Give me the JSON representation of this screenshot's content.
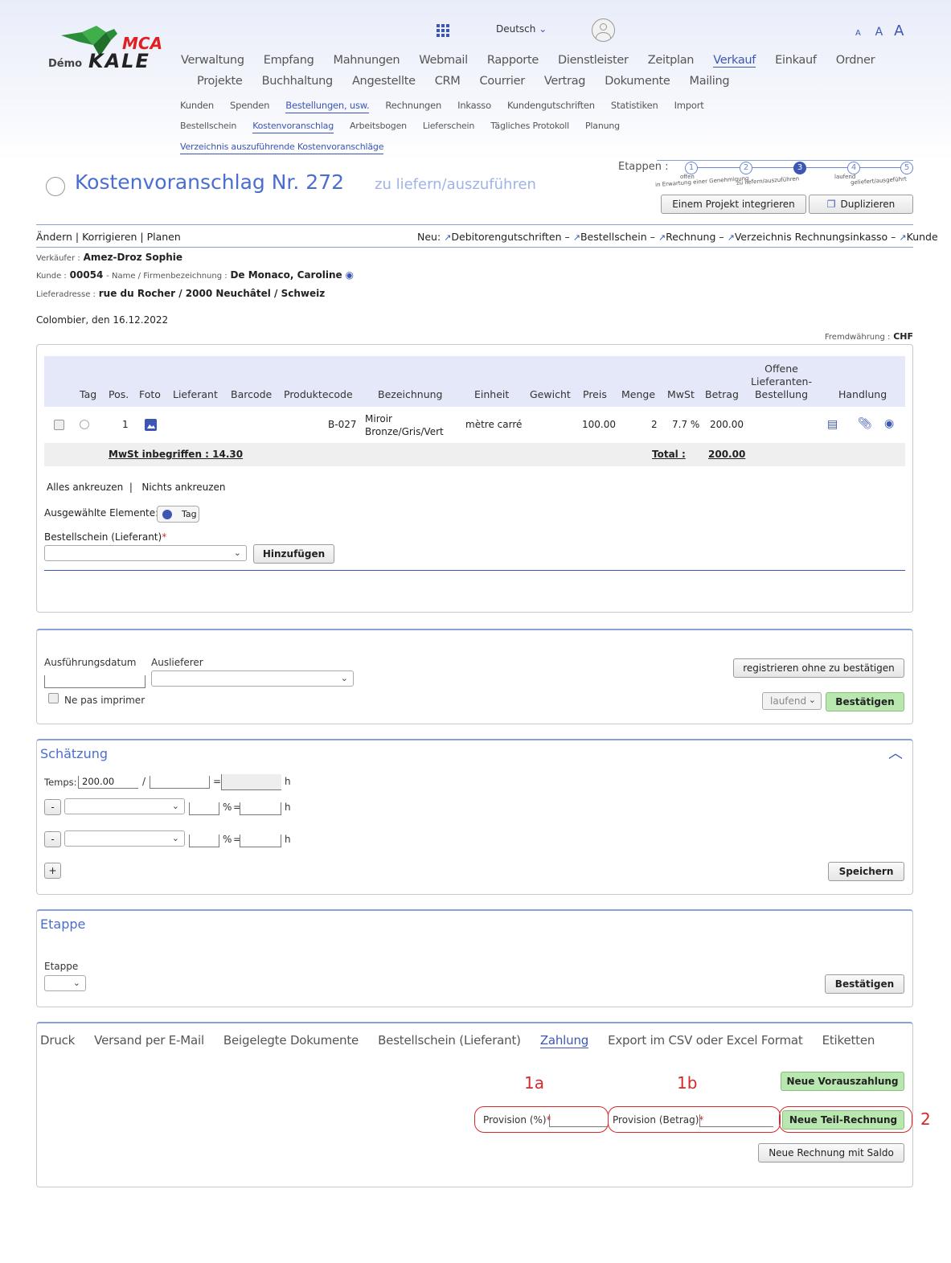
{
  "header": {
    "logo_mca": "MCA",
    "logo_demo": "Démo",
    "logo_kale": "KALE",
    "language": "Deutsch",
    "font_sizes": [
      "A",
      "A",
      "A"
    ],
    "nav_main_row1": [
      "Verwaltung",
      "Empfang",
      "Mahnungen",
      "Webmail",
      "Rapporte",
      "Dienstleister",
      "Zeitplan",
      "Verkauf",
      "Einkauf",
      "Ordner"
    ],
    "nav_main_row2": [
      "Projekte",
      "Buchhaltung",
      "Angestellte",
      "CRM",
      "Courrier",
      "Vertrag",
      "Dokumente",
      "Mailing"
    ],
    "nav_sub_row1": [
      "Kunden",
      "Spenden",
      "Bestellungen, usw.",
      "Rechnungen",
      "Inkasso",
      "Kundengutschriften",
      "Statistiken",
      "Import"
    ],
    "nav_sub_row2": [
      "Bestellschein",
      "Kostenvoranschlag",
      "Arbeitsbogen",
      "Lieferschein",
      "Tägliches Protokoll",
      "Planung"
    ],
    "nav_sub_row3": [
      "Verzeichnis auszuführende Kostenvoranschläge"
    ]
  },
  "title": {
    "main": "Kostenvoranschlag Nr. 272",
    "status": "zu liefern/auszuführen",
    "stages_label": "Etappen :",
    "stages": [
      {
        "num": "1",
        "label": "offen",
        "sub": ""
      },
      {
        "num": "2",
        "label": "in Erwartung einer Genehmigung",
        "sub": ""
      },
      {
        "num": "3",
        "label": "zu liefern/auszuführen",
        "sub": ""
      },
      {
        "num": "4",
        "label": "laufend",
        "sub": ""
      },
      {
        "num": "5",
        "label": "geliefert/ausgeführt",
        "sub": ""
      }
    ],
    "btn_project": "Einem Projekt integrieren",
    "btn_duplicate": "Duplizieren"
  },
  "actions": {
    "left": "Ändern | Korrigieren | Planen",
    "new_label": "Neu:",
    "new_items": [
      "Debitorengutschriften",
      "Bestellschein",
      "Rechnung",
      "Verzeichnis Rechnungsinkasso",
      "Kunde"
    ]
  },
  "info": {
    "seller_label": "Verkäufer :",
    "seller": "Amez-Droz Sophie",
    "client_label": "Kunde :",
    "client_no": "00054",
    "name_label": "- Name / Firmenbezeichnung :",
    "client_name": "De Monaco, Caroline",
    "address_label": "Lieferadresse :",
    "address": "rue du Rocher / 2000 Neuchâtel / Schweiz",
    "place_date": "Colombier, den 16.12.2022",
    "currency_label": "Fremdwährung :",
    "currency": "CHF"
  },
  "table": {
    "headers": [
      "Tag",
      "Pos.",
      "Foto",
      "Lieferant",
      "Barcode",
      "Produktecode",
      "Bezeichnung",
      "Einheit",
      "Gewicht",
      "Preis",
      "Menge",
      "MwSt",
      "Betrag",
      "Offene Lieferanten-Bestellung",
      "Handlung"
    ],
    "rows": [
      {
        "pos": "1",
        "code": "B-027",
        "designation": "Miroir Bronze/Gris/Vert",
        "unit": "mètre carré",
        "price": "100.00",
        "qty": "2",
        "vat": "7.7 %",
        "amount": "200.00"
      }
    ],
    "vat_included": "MwSt inbegriffen : 14.30",
    "total_label": "Total :",
    "total": "200.00",
    "check_all": "Alles ankreuzen",
    "uncheck_all": "Nichts ankreuzen",
    "selected_label": "Ausgewählte Elemente:",
    "tag_button": "Tag",
    "order_label": "Bestellschein (Lieferant)",
    "add_button": "Hinzufügen"
  },
  "exec": {
    "date_label": "Ausführungsdatum",
    "deliverer_label": "Auslieferer",
    "no_print": "Ne pas imprimer",
    "btn_register": "registrieren ohne zu bestätigen",
    "status_select": "laufend",
    "btn_confirm": "Bestätigen"
  },
  "estimate": {
    "title": "Schätzung",
    "time_label": "Temps:",
    "time_value": "200.00",
    "unit": "h",
    "percent": "%",
    "equals": "=",
    "slash": "/",
    "minus": "-",
    "plus": "+",
    "btn_save": "Speichern"
  },
  "stage": {
    "title": "Etappe",
    "label": "Etappe",
    "btn_confirm": "Bestätigen"
  },
  "payment": {
    "tabs": [
      "Druck",
      "Versand per E-Mail",
      "Beigelegte Dokumente",
      "Bestellschein (Lieferant)",
      "Zahlung",
      "Export im CSV oder Excel Format",
      "Etiketten"
    ],
    "btn_advance": "Neue Vorauszahlung",
    "provision_pct": "Provision (%)",
    "provision_amt": "Provision (Betrag)",
    "btn_partial": "Neue Teil-Rechnung",
    "btn_balance": "Neue Rechnung mit Saldo",
    "annot_1a": "1a",
    "annot_1b": "1b",
    "annot_2": "2"
  },
  "colors": {
    "accent": "#3b56b4",
    "green": "#b9e7b0",
    "annotation": "#d42a2a",
    "table_header": "#e4e8f8"
  }
}
